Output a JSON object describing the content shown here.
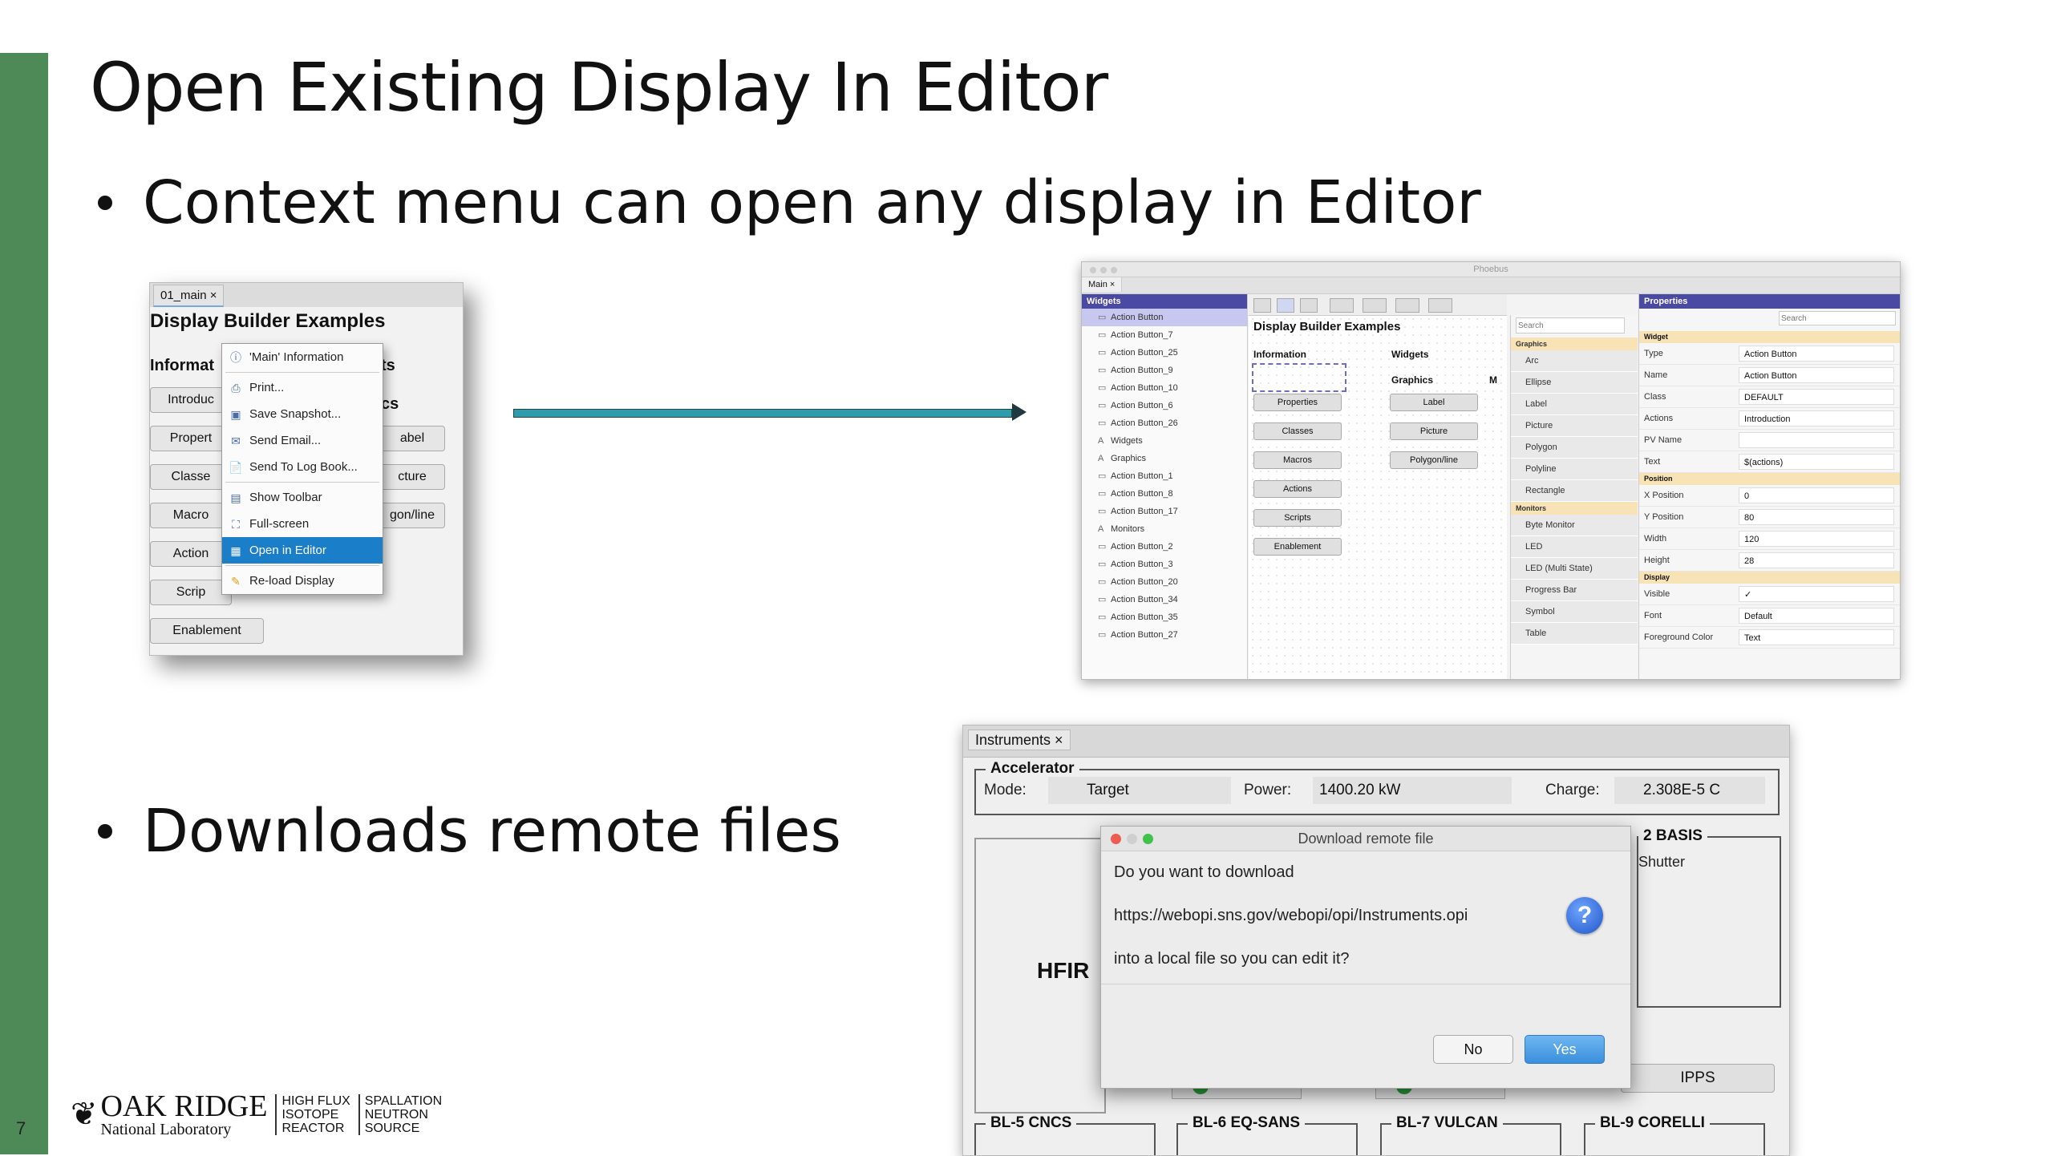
{
  "slide": {
    "number": "7",
    "title": "Open Existing Display In Editor",
    "bullets": [
      "Context menu can open any display in Editor",
      "Downloads remote files"
    ]
  },
  "window1": {
    "tab": "01_main ×",
    "heading": "Display Builder Examples",
    "col1_heading": "Informat",
    "col2_heading": "ts",
    "sub_heading": "cs",
    "buttons_left": [
      "Introduc",
      "Propert",
      "Classe",
      "Macro",
      "Action",
      "Scrip",
      "Enablement"
    ],
    "buttons_right": [
      "abel",
      "cture",
      "gon/line"
    ],
    "context_menu": [
      {
        "label": "'Main' Information",
        "icon": "info-icon"
      },
      {
        "label": "Print...",
        "icon": "print-icon"
      },
      {
        "label": "Save Snapshot...",
        "icon": "snapshot-icon"
      },
      {
        "label": "Send Email...",
        "icon": "email-icon"
      },
      {
        "label": "Send To Log Book...",
        "icon": "logbook-icon"
      },
      {
        "label": "Show Toolbar",
        "icon": "toolbar-icon"
      },
      {
        "label": "Full-screen",
        "icon": "fullscreen-icon"
      },
      {
        "label": "Open in Editor",
        "icon": "editor-icon",
        "selected": true
      },
      {
        "label": "Re-load Display",
        "icon": "reload-icon"
      }
    ]
  },
  "window2": {
    "title": "Phoebus",
    "tab": "Main ×",
    "widgets_header": "Widgets",
    "properties_header": "Properties",
    "tree": [
      "Action Button",
      "Action Button_7",
      "Action Button_25",
      "Action Button_9",
      "Action Button_10",
      "Action Button_6",
      "Action Button_26",
      "Widgets",
      "Graphics",
      "Action Button_1",
      "Action Button_8",
      "Action Button_17",
      "Monitors",
      "Action Button_2",
      "Action Button_3",
      "Action Button_20",
      "Action Button_34",
      "Action Button_35",
      "Action Button_27"
    ],
    "canvas": {
      "heading": "Display Builder Examples",
      "col1": "Information",
      "col2": "Widgets",
      "col2_sub": "Graphics",
      "col3": "M",
      "left_buttons": [
        "Properties",
        "Classes",
        "Macros",
        "Actions",
        "Scripts",
        "Enablement"
      ],
      "right_buttons": [
        "Label",
        "Picture",
        "Polygon/line"
      ]
    },
    "search_placeholder": "Search",
    "palette": [
      {
        "type": "cat",
        "label": "Graphics"
      },
      {
        "type": "item",
        "label": "Arc"
      },
      {
        "type": "item",
        "label": "Ellipse"
      },
      {
        "type": "item",
        "label": "Label"
      },
      {
        "type": "item",
        "label": "Picture"
      },
      {
        "type": "item",
        "label": "Polygon"
      },
      {
        "type": "item",
        "label": "Polyline"
      },
      {
        "type": "item",
        "label": "Rectangle"
      },
      {
        "type": "cat",
        "label": "Monitors"
      },
      {
        "type": "item",
        "label": "Byte Monitor"
      },
      {
        "type": "item",
        "label": "LED"
      },
      {
        "type": "item",
        "label": "LED (Multi State)"
      },
      {
        "type": "item",
        "label": "Progress Bar"
      },
      {
        "type": "item",
        "label": "Symbol"
      },
      {
        "type": "item",
        "label": "Table"
      }
    ],
    "properties": [
      {
        "type": "cat",
        "label": "Widget"
      },
      {
        "type": "row",
        "key": "Type",
        "value": "Action Button"
      },
      {
        "type": "row",
        "key": "Name",
        "value": "Action Button"
      },
      {
        "type": "row",
        "key": "Class",
        "value": "DEFAULT"
      },
      {
        "type": "row",
        "key": "Actions",
        "value": "Introduction"
      },
      {
        "type": "row",
        "key": "PV Name",
        "value": ""
      },
      {
        "type": "row",
        "key": "Text",
        "value": "$(actions)"
      },
      {
        "type": "cat",
        "label": "Position"
      },
      {
        "type": "row",
        "key": "X Position",
        "value": "0"
      },
      {
        "type": "row",
        "key": "Y Position",
        "value": "80"
      },
      {
        "type": "row",
        "key": "Width",
        "value": "120"
      },
      {
        "type": "row",
        "key": "Height",
        "value": "28"
      },
      {
        "type": "cat",
        "label": "Display"
      },
      {
        "type": "row",
        "key": "Visible",
        "value": "✓"
      },
      {
        "type": "row",
        "key": "Font",
        "value": "Default"
      },
      {
        "type": "row",
        "key": "Foreground Color",
        "value": "Text"
      }
    ]
  },
  "window3": {
    "tab": "Instruments ×",
    "accelerator_legend": "Accelerator",
    "mode_label": "Mode:",
    "mode_value": "Target",
    "power_label": "Power:",
    "power_value": "1400.20 kW",
    "charge_label": "Charge:",
    "charge_value": "2.308E-5 C",
    "basis_legend": "2 BASIS",
    "shutter_label": "Shutter",
    "hfir_label": "HFIR",
    "ipps_label": "IPPS",
    "bottom_legends": [
      "BL-5 CNCS",
      "BL-6 EQ-SANS",
      "BL-7 VULCAN",
      "BL-9 CORELLI"
    ],
    "dialog": {
      "title": "Download remote file",
      "line1": "Do you want to download",
      "url": "https://webopi.sns.gov/webopi/opi/Instruments.opi",
      "line3": "into a local file so you can edit it?",
      "no_label": "No",
      "yes_label": "Yes"
    }
  },
  "logo": {
    "main_big": "OAK RIDGE",
    "main_small": "National Laboratory",
    "col1": [
      "HIGH FLUX",
      "ISOTOPE",
      "REACTOR"
    ],
    "col2": [
      "SPALLATION",
      "NEUTRON",
      "SOURCE"
    ]
  },
  "colors": {
    "sidebar": "#4e8a57",
    "arrow": "#2f9cae",
    "selection": "#1b7ec8",
    "panel_header": "#4a4aa5",
    "category": "#f7e3b5"
  }
}
